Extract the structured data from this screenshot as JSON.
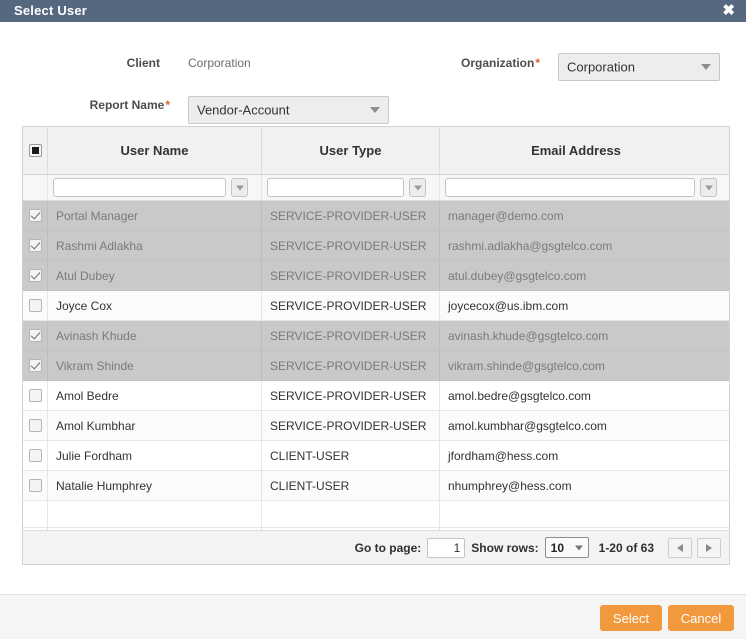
{
  "dialog": {
    "title": "Select User",
    "close_icon": "close-icon"
  },
  "form": {
    "client_label": "Client",
    "client_value": "Corporation",
    "report_label": "Report Name",
    "report_value": "Vendor-Account",
    "organization_label": "Organization",
    "organization_value": "Corporation",
    "required_marker": "*"
  },
  "grid": {
    "columns": [
      "User Name",
      "User Type",
      "Email Address"
    ],
    "select_all_state": "indeterminate",
    "filters": {
      "user_name": "",
      "user_type": "",
      "email_address": ""
    },
    "rows": [
      {
        "selected": true,
        "name": "Portal Manager",
        "type": "SERVICE-PROVIDER-USER",
        "email": "manager@demo.com"
      },
      {
        "selected": true,
        "name": "Rashmi Adlakha",
        "type": "SERVICE-PROVIDER-USER",
        "email": "rashmi.adlakha@gsgtelco.com"
      },
      {
        "selected": true,
        "name": "Atul Dubey",
        "type": "SERVICE-PROVIDER-USER",
        "email": "atul.dubey@gsgtelco.com"
      },
      {
        "selected": false,
        "name": "Joyce Cox",
        "type": "SERVICE-PROVIDER-USER",
        "email": "joycecox@us.ibm.com"
      },
      {
        "selected": true,
        "name": "Avinash Khude",
        "type": "SERVICE-PROVIDER-USER",
        "email": "avinash.khude@gsgtelco.com"
      },
      {
        "selected": true,
        "name": "Vikram Shinde",
        "type": "SERVICE-PROVIDER-USER",
        "email": "vikram.shinde@gsgtelco.com"
      },
      {
        "selected": false,
        "name": "Amol Bedre",
        "type": "SERVICE-PROVIDER-USER",
        "email": "amol.bedre@gsgtelco.com"
      },
      {
        "selected": false,
        "name": "Amol Kumbhar",
        "type": "SERVICE-PROVIDER-USER",
        "email": "amol.kumbhar@gsgtelco.com"
      },
      {
        "selected": false,
        "name": "Julie Fordham",
        "type": "CLIENT-USER",
        "email": "jfordham@hess.com"
      },
      {
        "selected": false,
        "name": "Natalie Humphrey",
        "type": "CLIENT-USER",
        "email": "nhumphrey@hess.com"
      }
    ]
  },
  "pagination": {
    "go_to_page_label": "Go to page:",
    "page_value": "1",
    "show_rows_label": "Show rows:",
    "rows_per_page": "10",
    "range_text": "1-20 of 63",
    "prev_icon": "chevron-left-icon",
    "next_icon": "chevron-right-icon"
  },
  "footer": {
    "select_label": "Select",
    "cancel_label": "Cancel"
  },
  "colors": {
    "titlebar": "#56687f",
    "button_orange": "#f2993d",
    "selected_row": "#c9c9c9",
    "required_star": "#e0622a"
  }
}
